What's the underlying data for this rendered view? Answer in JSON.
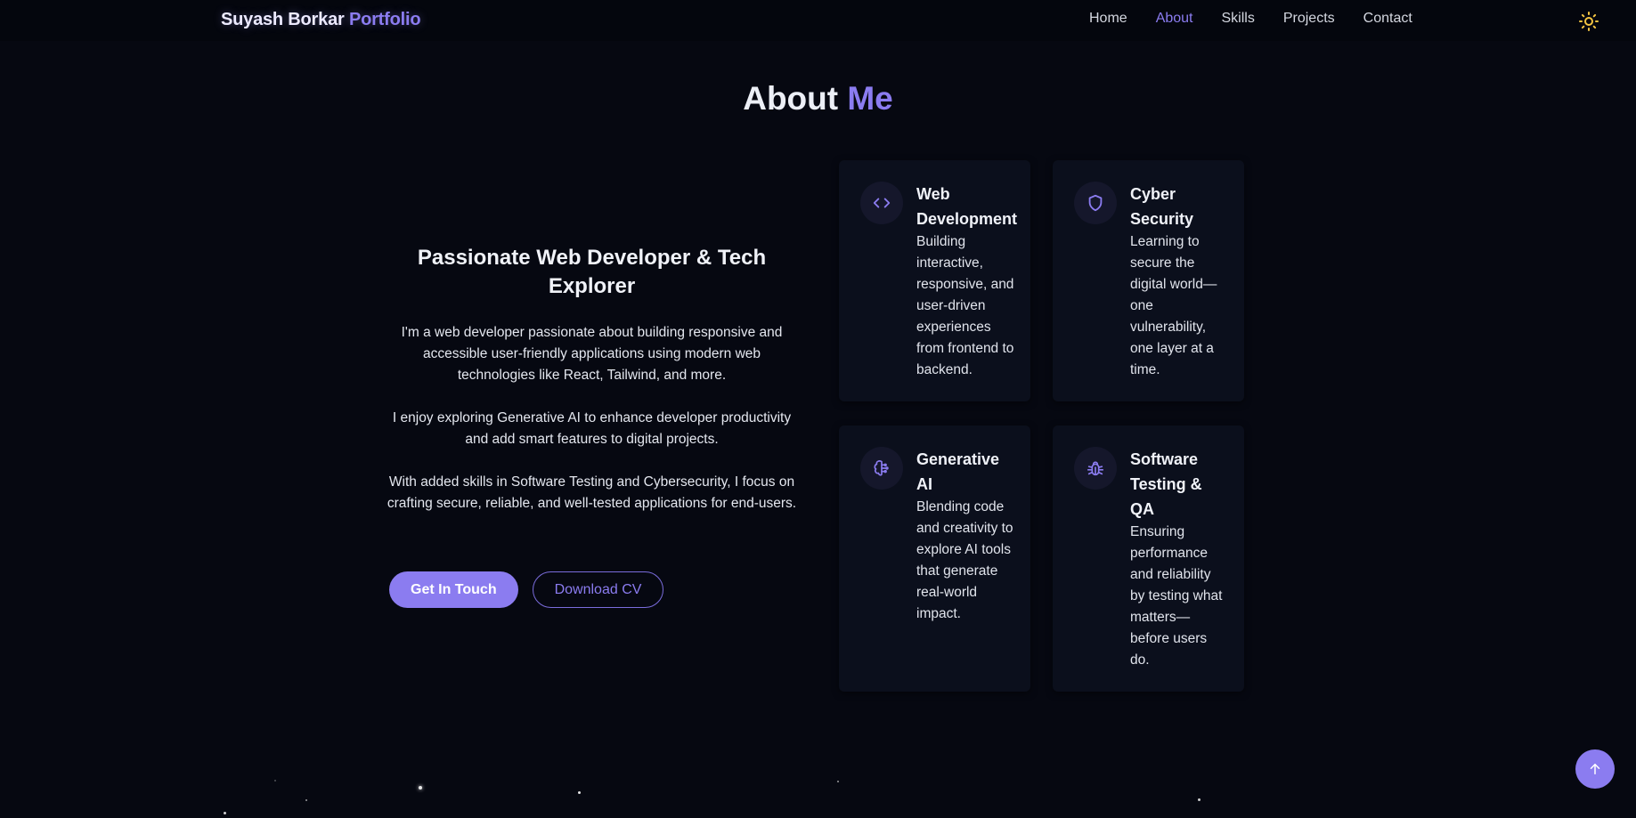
{
  "header": {
    "brand_name": "Suyash Borkar",
    "brand_accent": "Portfolio",
    "nav": [
      {
        "label": "Home",
        "active": false
      },
      {
        "label": "About",
        "active": true
      },
      {
        "label": "Skills",
        "active": false
      },
      {
        "label": "Projects",
        "active": false
      },
      {
        "label": "Contact",
        "active": false
      }
    ],
    "theme_toggle_icon": "sun-icon"
  },
  "section": {
    "title": "About",
    "title_accent": "Me"
  },
  "intro": {
    "heading": "Passionate Web Developer & Tech Explorer",
    "paragraphs": [
      "I'm a web developer passionate about building responsive and accessible user-friendly applications using modern web technologies like React, Tailwind, and more.",
      "I enjoy exploring Generative AI to enhance developer productivity and add smart features to digital projects.",
      "With added skills in Software Testing and Cybersecurity, I focus on crafting secure, reliable, and well-tested applications for end-users."
    ],
    "primary_button": "Get In Touch",
    "secondary_button": "Download CV"
  },
  "cards": [
    {
      "icon": "code-icon",
      "title": "Web Development",
      "description": "Building interactive, responsive, and user-driven experiences from frontend to backend."
    },
    {
      "icon": "shield-icon",
      "title": "Cyber Security",
      "description": "Learning to secure the digital world—one vulnerability, one layer at a time."
    },
    {
      "icon": "brain-icon",
      "title": "Generative AI",
      "description": "Blending code and creativity to explore AI tools that generate real-world impact."
    },
    {
      "icon": "bug-icon",
      "title": "Software Testing & QA",
      "description": "Ensuring performance and reliability by testing what matters—before users do."
    }
  ],
  "scroll_top_icon": "arrow-up-icon",
  "colors": {
    "accent": "#8b7cf0",
    "background": "#060811",
    "card": "#0b0f1c"
  }
}
